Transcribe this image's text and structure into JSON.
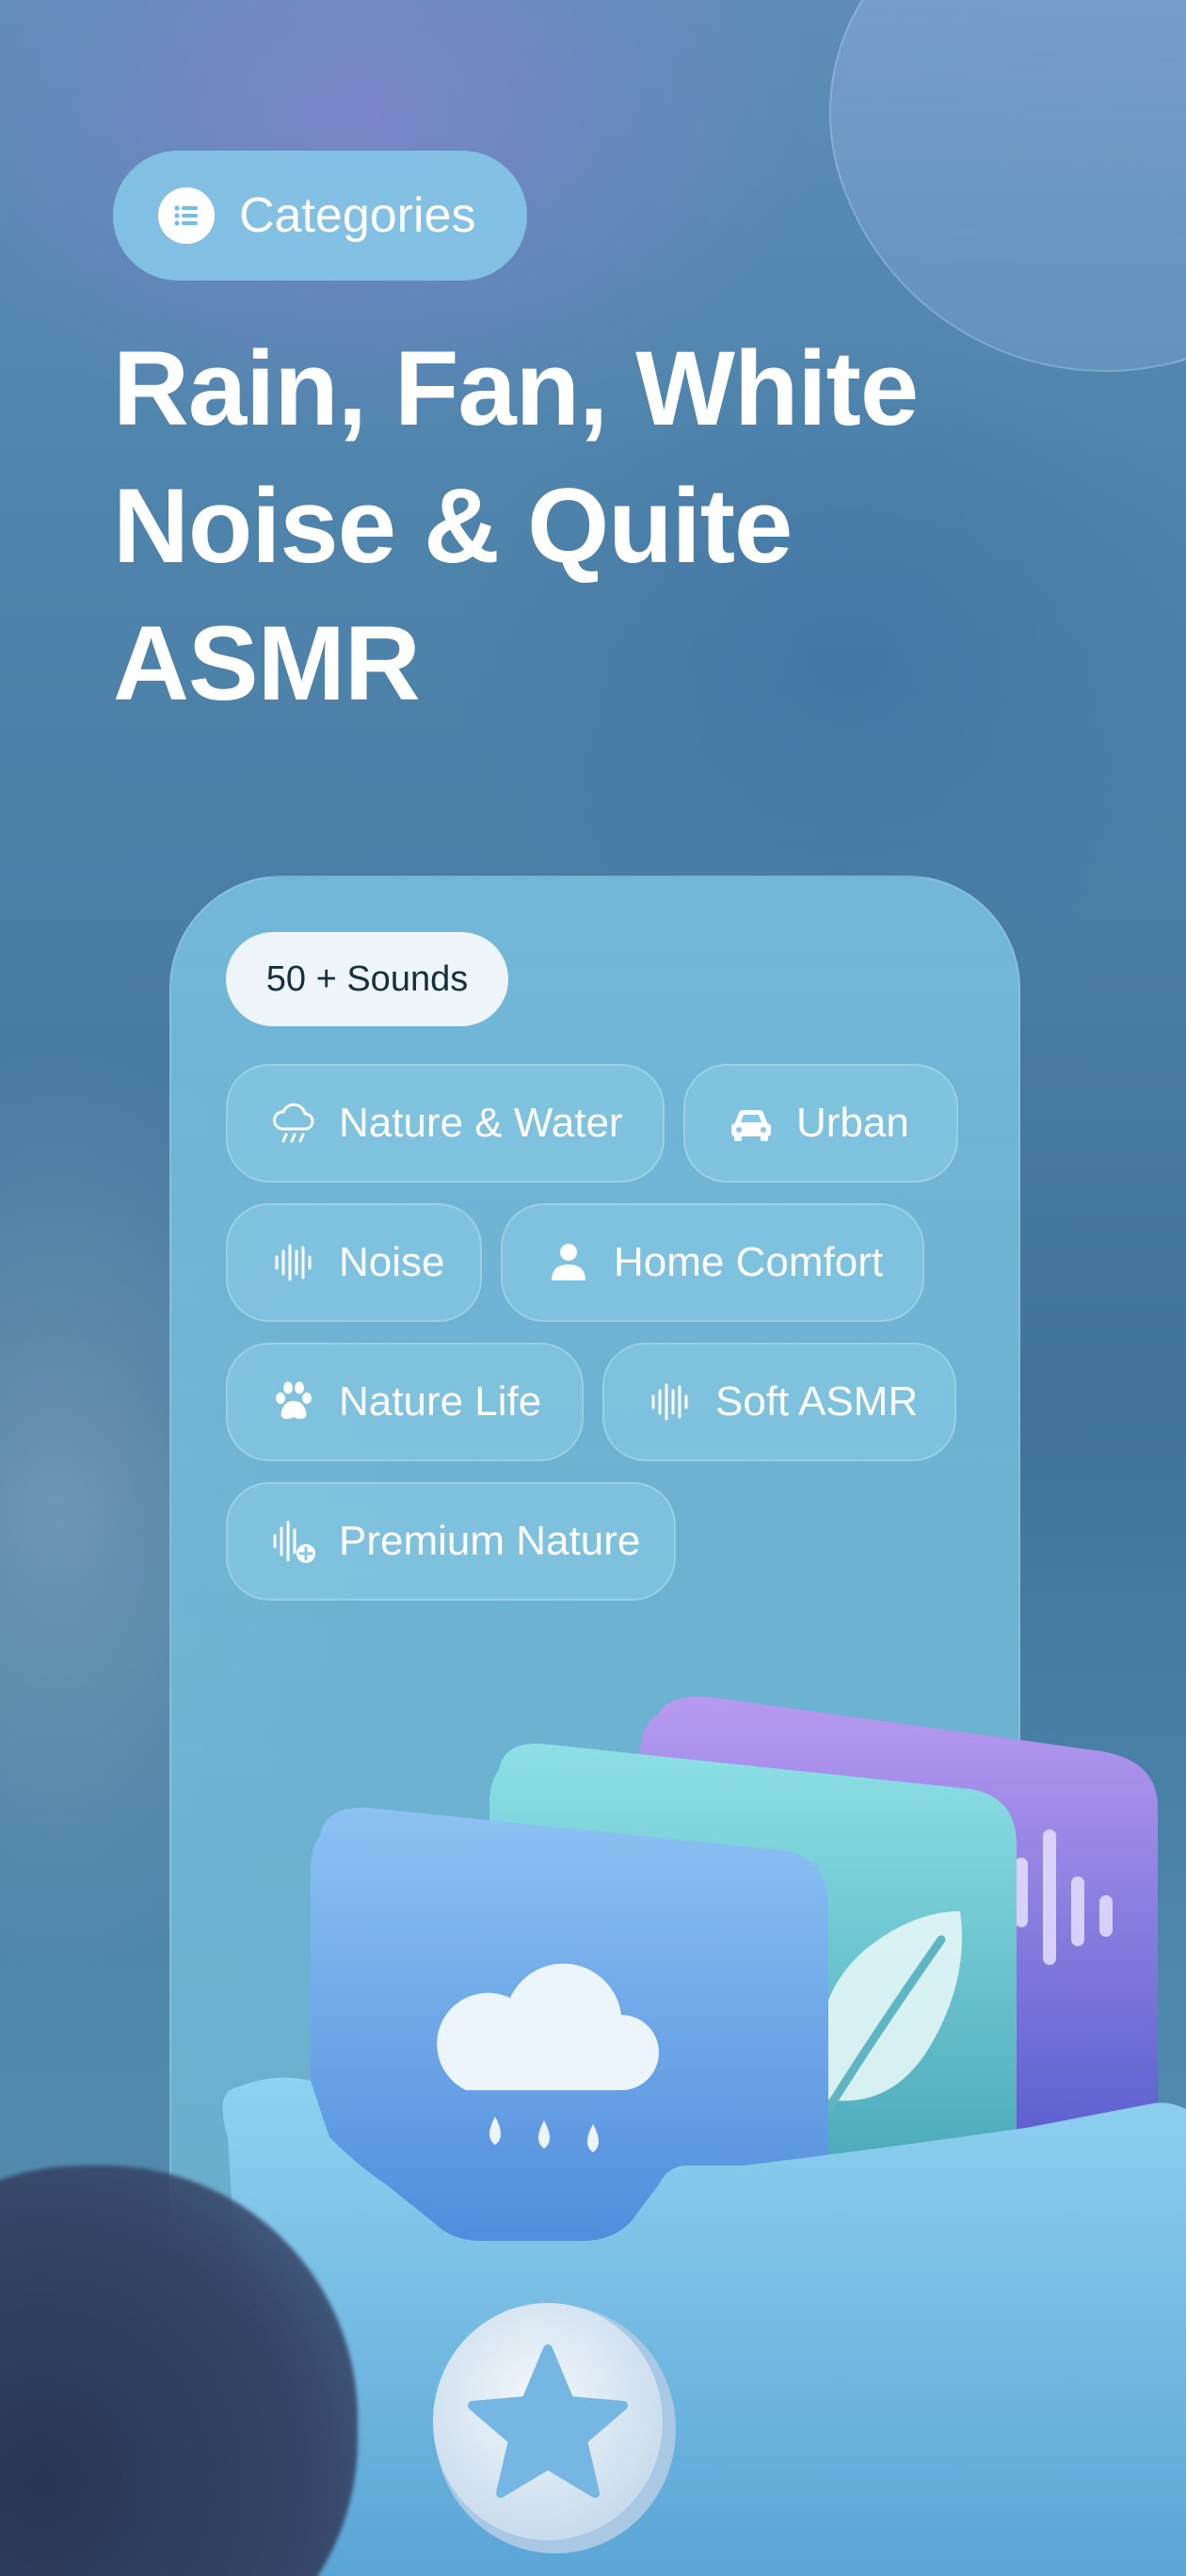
{
  "header": {
    "categories_label": "Categories",
    "categories_icon": "list-icon",
    "headline_line1": "Rain, Fan, White",
    "headline_line2": "Noise & Quite",
    "headline_line3": "ASMR"
  },
  "panel": {
    "count_label": "50 + Sounds",
    "chips": [
      {
        "label": "Nature & Water",
        "icon": "cloud-rain-icon"
      },
      {
        "label": "Urban",
        "icon": "car-icon"
      },
      {
        "label": "Noise",
        "icon": "waveform-icon"
      },
      {
        "label": "Home Comfort",
        "icon": "person-icon"
      },
      {
        "label": "Nature Life",
        "icon": "paw-icon"
      },
      {
        "label": "Soft ASMR",
        "icon": "waveform-icon"
      },
      {
        "label": "Premium Nature",
        "icon": "waveform-plus-icon"
      }
    ]
  },
  "illustration": {
    "cards": [
      "cloud-rain-icon",
      "leaf-icon",
      "waveform-icon"
    ],
    "badge_icon": "star-icon"
  },
  "colors": {
    "background": "#4b7ea5",
    "pill": "#87cdeb",
    "card_blue": "#6aa6e6",
    "card_teal": "#66c4d0",
    "card_purple": "#8f7ae8",
    "box": "#7fc6ea"
  }
}
